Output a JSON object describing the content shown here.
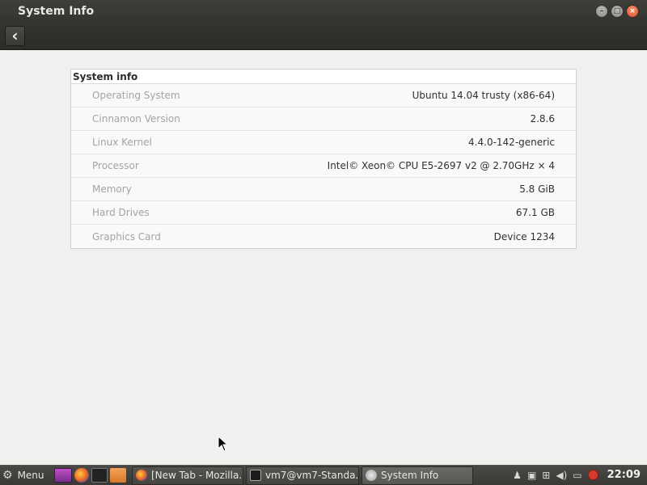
{
  "window": {
    "title": "System Info",
    "controls": {
      "minimize": "–",
      "maximize": "□",
      "close": "×"
    }
  },
  "toolbar": {
    "back_icon": "chevron-left-icon",
    "back_glyph": "‹"
  },
  "info": {
    "header": "System info",
    "rows": [
      {
        "label": "Operating System",
        "value": "Ubuntu 14.04 trusty (x86-64)"
      },
      {
        "label": "Cinnamon Version",
        "value": "2.8.6"
      },
      {
        "label": "Linux Kernel",
        "value": "4.4.0-142-generic"
      },
      {
        "label": "Processor",
        "value": "Intel© Xeon© CPU E5-2697 v2 @ 2.70GHz × 4"
      },
      {
        "label": "Memory",
        "value": "5.8 GiB"
      },
      {
        "label": "Hard Drives",
        "value": "67.1 GB"
      },
      {
        "label": "Graphics Card",
        "value": "Device 1234"
      }
    ]
  },
  "taskbar": {
    "menu_label": "Menu",
    "tasks": [
      {
        "label": "[New Tab - Mozilla...",
        "icon": "firefox-icon"
      },
      {
        "label": "vm7@vm7-Standa...",
        "icon": "terminal-icon"
      },
      {
        "label": "System Info",
        "icon": "system-info-icon"
      }
    ],
    "clock": "22:09"
  }
}
